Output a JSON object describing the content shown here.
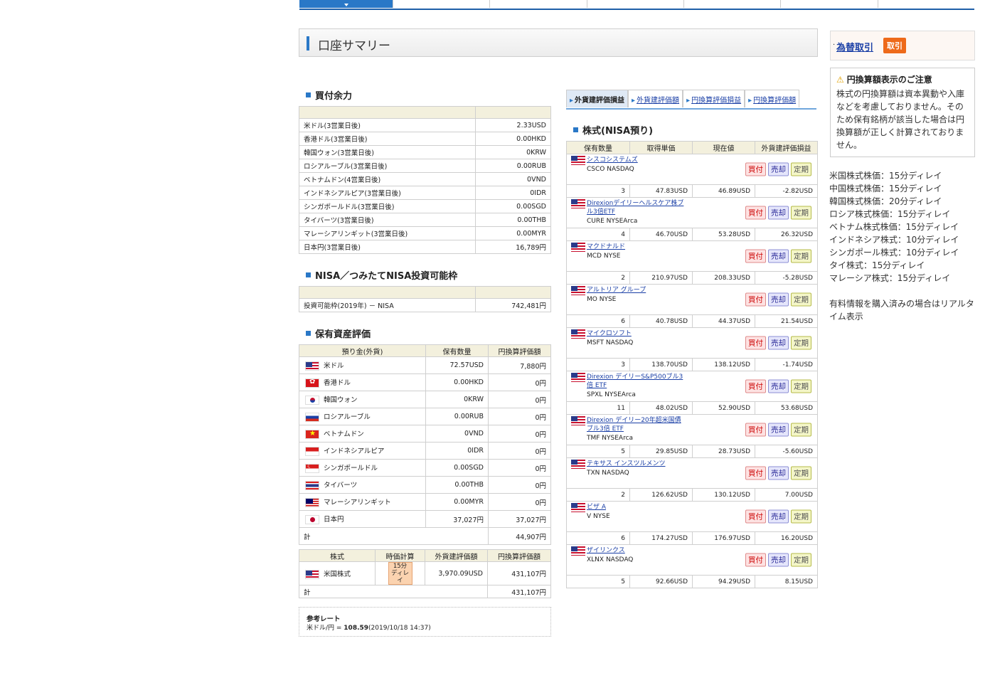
{
  "page": {
    "title": "口座サマリー"
  },
  "buying_power": {
    "title": "買付余力",
    "rows": [
      {
        "label": "米ドル(3営業日後)",
        "value": "2.33USD"
      },
      {
        "label": "香港ドル(3営業日後)",
        "value": "0.00HKD"
      },
      {
        "label": "韓国ウォン(3営業日後)",
        "value": "0KRW"
      },
      {
        "label": "ロシアルーブル(3営業日後)",
        "value": "0.00RUB"
      },
      {
        "label": "ベトナムドン(4営業日後)",
        "value": "0VND"
      },
      {
        "label": "インドネシアルピア(3営業日後)",
        "value": "0IDR"
      },
      {
        "label": "シンガポールドル(3営業日後)",
        "value": "0.00SGD"
      },
      {
        "label": "タイバーツ(3営業日後)",
        "value": "0.00THB"
      },
      {
        "label": "マレーシアリンギット(3営業日後)",
        "value": "0.00MYR"
      },
      {
        "label": "日本円(3営業日後)",
        "value": "16,789円"
      }
    ]
  },
  "nisa_limit": {
    "title": "NISA／つみたてNISA投資可能枠",
    "rows": [
      {
        "label": "投資可能枠(2019年) － NISA",
        "value": "742,481円"
      }
    ]
  },
  "assets": {
    "title": "保有資産評価",
    "headers": [
      "預り金(外貨)",
      "保有数量",
      "円換算評価額"
    ],
    "rows": [
      {
        "flag": "us",
        "name": "米ドル",
        "qty": "72.57USD",
        "jpy": "7,880円"
      },
      {
        "flag": "hk",
        "name": "香港ドル",
        "qty": "0.00HKD",
        "jpy": "0円"
      },
      {
        "flag": "kr",
        "name": "韓国ウォン",
        "qty": "0KRW",
        "jpy": "0円"
      },
      {
        "flag": "ru",
        "name": "ロシアルーブル",
        "qty": "0.00RUB",
        "jpy": "0円"
      },
      {
        "flag": "vn",
        "name": "ベトナムドン",
        "qty": "0VND",
        "jpy": "0円"
      },
      {
        "flag": "id",
        "name": "インドネシアルピア",
        "qty": "0IDR",
        "jpy": "0円"
      },
      {
        "flag": "sg",
        "name": "シンガポールドル",
        "qty": "0.00SGD",
        "jpy": "0円"
      },
      {
        "flag": "th",
        "name": "タイバーツ",
        "qty": "0.00THB",
        "jpy": "0円"
      },
      {
        "flag": "my",
        "name": "マレーシアリンギット",
        "qty": "0.00MYR",
        "jpy": "0円"
      },
      {
        "flag": "jp",
        "name": "日本円",
        "qty": "37,027円",
        "jpy": "37,027円"
      }
    ],
    "total_label": "計",
    "total_value": "44,907円"
  },
  "stocks_summary": {
    "headers": [
      "株式",
      "時価計算",
      "外貨建評価額",
      "円換算評価額"
    ],
    "row": {
      "name": "米国株式",
      "delay": "15分ディレイ",
      "foreign": "3,970.09USD",
      "jpy": "431,107円"
    },
    "total_label": "計",
    "total_value": "431,107円"
  },
  "ref_rate": {
    "title": "参考レート",
    "label": "米ドル/円 = ",
    "value": "108.59",
    "time": "(2019/10/18 14:37)"
  },
  "eval_tabs": [
    "外貨建評価損益",
    "外貨建評価額",
    "円換算評価損益",
    "円換算評価額"
  ],
  "nisa_stocks": {
    "title": "株式(NISA預り)",
    "headers": [
      "保有数量",
      "取得単価",
      "現在値",
      "外貨建評価損益"
    ],
    "buttons": {
      "buy": "買付",
      "sell": "売却",
      "reg": "定期"
    },
    "items": [
      {
        "name": "シスコシステムズ",
        "code": "CSCO NASDAQ",
        "qty": "3",
        "cost": "47.83USD",
        "price": "46.89USD",
        "pl": "-2.82USD"
      },
      {
        "name": "Direxionデイリーヘルスケア株ブル3倍ETF",
        "code": "CURE NYSEArca",
        "qty": "4",
        "cost": "46.70USD",
        "price": "53.28USD",
        "pl": "26.32USD"
      },
      {
        "name": "マクドナルド",
        "code": "MCD NYSE",
        "qty": "2",
        "cost": "210.97USD",
        "price": "208.33USD",
        "pl": "-5.28USD"
      },
      {
        "name": "アルトリア グループ",
        "code": "MO NYSE",
        "qty": "6",
        "cost": "40.78USD",
        "price": "44.37USD",
        "pl": "21.54USD"
      },
      {
        "name": "マイクロソフト",
        "code": "MSFT NASDAQ",
        "qty": "3",
        "cost": "138.70USD",
        "price": "138.12USD",
        "pl": "-1.74USD"
      },
      {
        "name": "Direxion デイリーS&P500ブル3倍 ETF",
        "code": "SPXL NYSEArca",
        "qty": "11",
        "cost": "48.02USD",
        "price": "52.90USD",
        "pl": "53.68USD"
      },
      {
        "name": "Direxion デイリー20年超米国債ブル3倍 ETF",
        "code": "TMF NYSEArca",
        "qty": "5",
        "cost": "29.85USD",
        "price": "28.73USD",
        "pl": "-5.60USD"
      },
      {
        "name": "テキサス インスツルメンツ",
        "code": "TXN NASDAQ",
        "qty": "2",
        "cost": "126.62USD",
        "price": "130.12USD",
        "pl": "7.00USD"
      },
      {
        "name": "ビザ A",
        "code": "V NYSE",
        "qty": "6",
        "cost": "174.27USD",
        "price": "176.97USD",
        "pl": "16.20USD"
      },
      {
        "name": "ザイリンクス",
        "code": "XLNX NASDAQ",
        "qty": "5",
        "cost": "92.66USD",
        "price": "94.29USD",
        "pl": "8.15USD"
      }
    ]
  },
  "fx": {
    "link": "為替取引",
    "trade": "取引"
  },
  "notice": {
    "title": "円換算額表示のご注意",
    "body": "株式の円換算額は資本異動や入庫などを考慮しておりません。そのため保有銘柄が該当した場合は円換算額が正しく計算されておりません。"
  },
  "delays": [
    "米国株式株価：15分ディレイ",
    "中国株式株価：15分ディレイ",
    "韓国株式株価：20分ディレイ",
    "ロシア株式株価：15分ディレイ",
    "ベトナム株式株価：15分ディレイ",
    "インドネシア株式：10分ディレイ",
    "シンガポール株式：10分ディレイ",
    "タイ株式：15分ディレイ",
    "マレーシア株式：15分ディレイ"
  ],
  "realtime_note": "有料情報を購入済みの場合はリアルタイム表示"
}
